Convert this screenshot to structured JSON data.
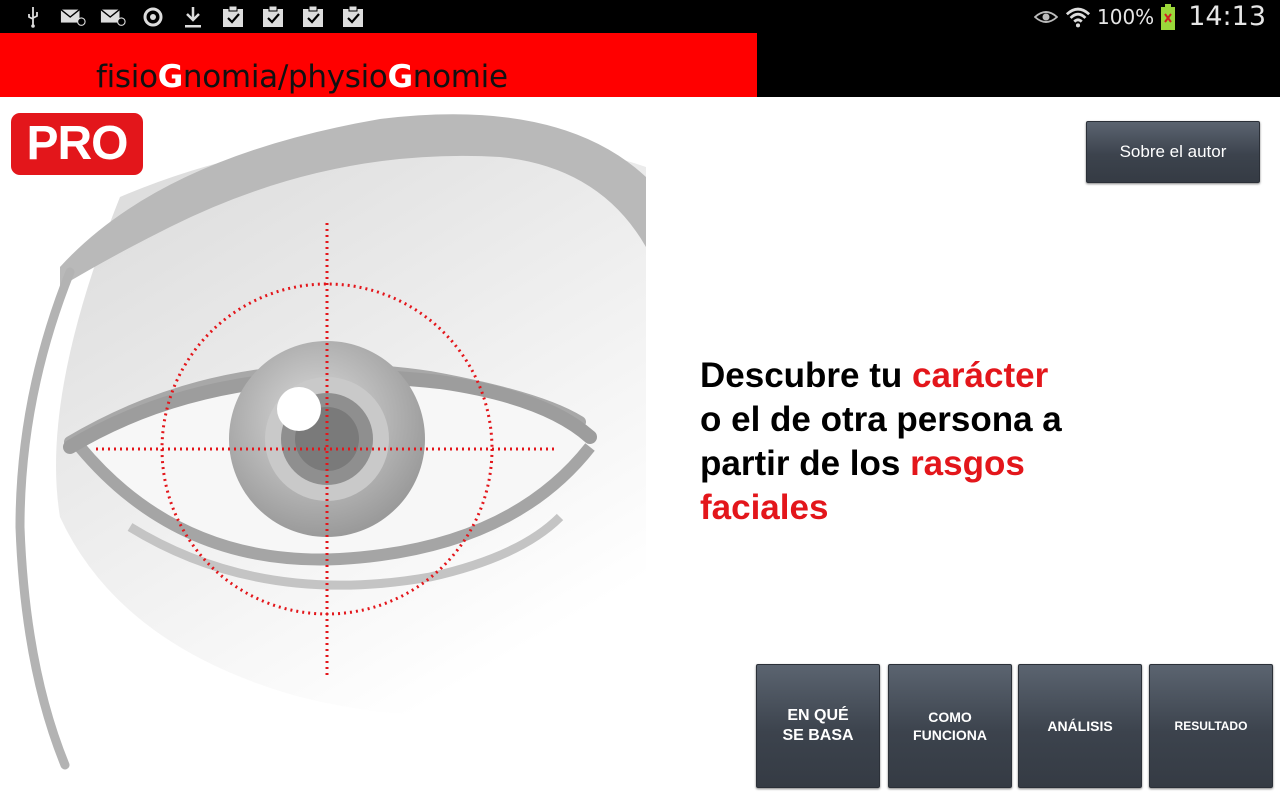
{
  "status_bar": {
    "left_icons": [
      "usb-icon",
      "email-icon",
      "email-icon",
      "sync-icon",
      "download-icon",
      "clipboard-check-icon",
      "clipboard-check-icon",
      "clipboard-check-icon",
      "clipboard-check-icon"
    ],
    "battery_percent": "100%",
    "time": "14:13"
  },
  "header": {
    "title_part1": "fisio",
    "title_g1": "G",
    "title_part2": "nomia/physio",
    "title_g2": "G",
    "title_part3": "nomie",
    "colors": {
      "red": "#ff0000",
      "black": "#000000"
    }
  },
  "badge": {
    "label": "PRO",
    "color": "#e3161b"
  },
  "about_button": {
    "label": "Sobre el autor"
  },
  "tagline": {
    "line1_a": "Descubre tu ",
    "line1_hl": "carácter",
    "line2": "o el de otra persona a",
    "line3_a": "partir de los ",
    "line3_hl": "rasgos",
    "line4_hl": "faciales",
    "highlight_color": "#e3161b"
  },
  "nav": [
    {
      "line1": "EN QUÉ",
      "line2": "SE BASA"
    },
    {
      "line1": "COMO",
      "line2": "FUNCIONA"
    },
    {
      "line1": "ANÁLISIS",
      "line2": ""
    },
    {
      "line1": "RESULTADO",
      "line2": ""
    }
  ]
}
